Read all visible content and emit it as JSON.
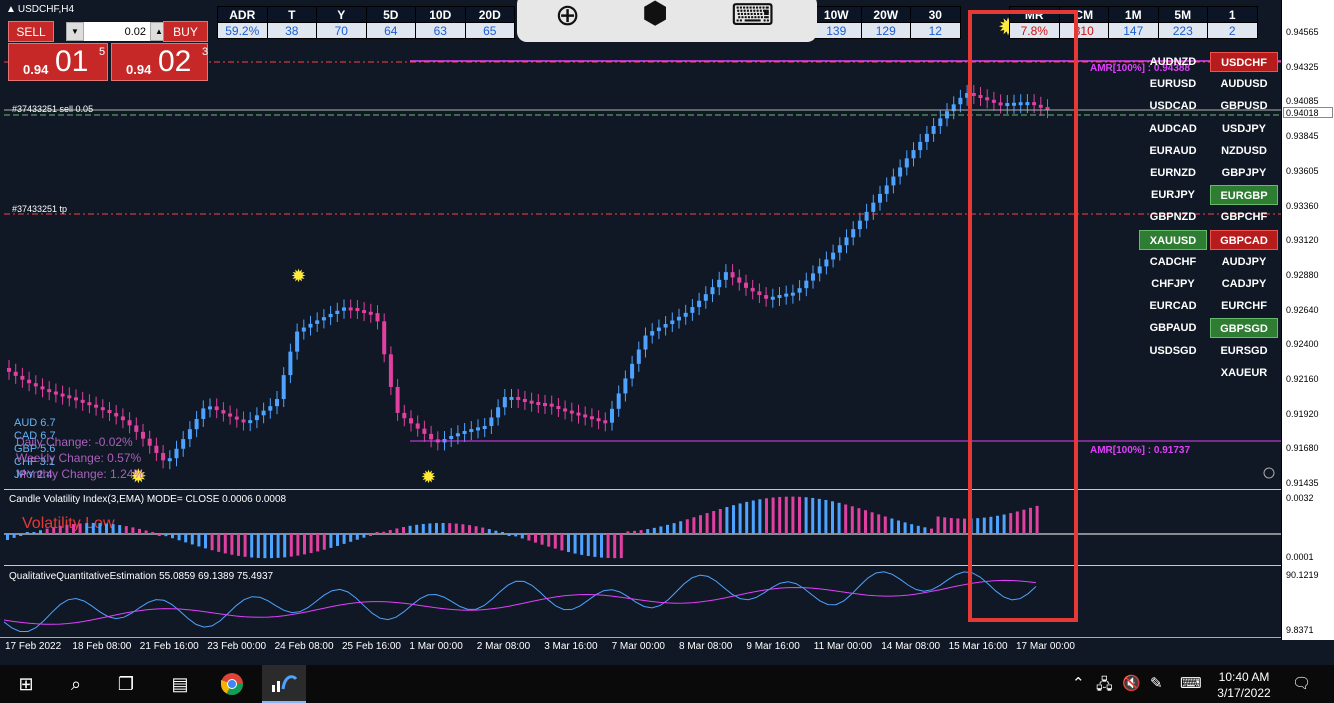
{
  "window": {
    "symbol": "USDCHF,H4"
  },
  "trade": {
    "sell_label": "SELL",
    "buy_label": "BUY",
    "lot": "0.02",
    "sell_small": "0.94",
    "sell_big": "01",
    "sell_sup": "5",
    "buy_small": "0.94",
    "buy_big": "02",
    "buy_sup": "3"
  },
  "stats": {
    "left": [
      {
        "h": "ADR",
        "v": "59.2%"
      },
      {
        "h": "T",
        "v": "38"
      },
      {
        "h": "Y",
        "v": "70"
      },
      {
        "h": "5D",
        "v": "64"
      },
      {
        "h": "10D",
        "v": "63"
      },
      {
        "h": "20D",
        "v": "65"
      }
    ],
    "right": [
      {
        "h": "10W",
        "v": "139"
      },
      {
        "h": "20W",
        "v": "129"
      },
      {
        "h": "30",
        "v": "12"
      }
    ],
    "right2": [
      {
        "h": "MR",
        "v": "7.8%",
        "red": true
      },
      {
        "h": "CM",
        "v": "310",
        "red": true
      },
      {
        "h": "1M",
        "v": "147"
      },
      {
        "h": "5M",
        "v": "223"
      },
      {
        "h": "1",
        "v": "2"
      }
    ],
    "frag": "3"
  },
  "price_axis": {
    "labels": [
      "0.94565",
      "0.94325",
      "0.94085",
      "0.93845",
      "0.93605",
      "0.93360",
      "0.93120",
      "0.92880",
      "0.92640",
      "0.92400",
      "0.92160",
      "0.91920",
      "0.91680",
      "0.91435"
    ],
    "current": "0.94018",
    "cvi_labels": [
      "0.0032",
      "0.0001"
    ],
    "qqe_labels": [
      "90.1219",
      "9.8371"
    ]
  },
  "orders": {
    "sell": "#37433251 sell 0.05",
    "tp": "#37433251 tp"
  },
  "amr": {
    "top": "AMR[100%] : 0.94388",
    "bottom": "AMR[100%] : 0.91737"
  },
  "pairs": [
    {
      "label": "AUDNZD",
      "style": ""
    },
    {
      "label": "USDCHF",
      "style": "red"
    },
    {
      "label": "EURUSD",
      "style": ""
    },
    {
      "label": "AUDUSD",
      "style": ""
    },
    {
      "label": "USDCAD",
      "style": ""
    },
    {
      "label": "GBPUSD",
      "style": ""
    },
    {
      "label": "AUDCAD",
      "style": ""
    },
    {
      "label": "USDJPY",
      "style": ""
    },
    {
      "label": "EURAUD",
      "style": ""
    },
    {
      "label": "NZDUSD",
      "style": ""
    },
    {
      "label": "EURNZD",
      "style": ""
    },
    {
      "label": "GBPJPY",
      "style": ""
    },
    {
      "label": "EURJPY",
      "style": ""
    },
    {
      "label": "EURGBP",
      "style": "green"
    },
    {
      "label": "GBPNZD",
      "style": ""
    },
    {
      "label": "GBPCHF",
      "style": ""
    },
    {
      "label": "XAUUSD",
      "style": "green"
    },
    {
      "label": "GBPCAD",
      "style": "red"
    },
    {
      "label": "CADCHF",
      "style": ""
    },
    {
      "label": "AUDJPY",
      "style": ""
    },
    {
      "label": "CHFJPY",
      "style": ""
    },
    {
      "label": "CADJPY",
      "style": ""
    },
    {
      "label": "EURCAD",
      "style": ""
    },
    {
      "label": "EURCHF",
      "style": ""
    },
    {
      "label": "GBPAUD",
      "style": ""
    },
    {
      "label": "GBPSGD",
      "style": "green"
    },
    {
      "label": "USDSGD",
      "style": ""
    },
    {
      "label": "EURSGD",
      "style": ""
    },
    {
      "label": "",
      "style": ""
    },
    {
      "label": "XAUEUR",
      "style": ""
    }
  ],
  "strength": [
    "AUD  6.7",
    "CAD  6.7",
    "GBP  5.6",
    "CHF  3.1",
    "JPY  2.4"
  ],
  "changes": [
    "Daily Change: -0.02%",
    "Weekly Change: 0.57%",
    "Monthly Change: 1.24%"
  ],
  "cvi": {
    "title": "Candle Volatility Index(3,EMA) MODE= CLOSE 0.0006 0.0008",
    "status": "Volatility Low"
  },
  "qqe": {
    "title": "QualitativeQuantitativeEstimation 55.0859 69.1389 75.4937"
  },
  "time_axis": [
    "17 Feb 2022",
    "18 Feb 08:00",
    "21 Feb 16:00",
    "23 Feb 00:00",
    "24 Feb 08:00",
    "25 Feb 16:00",
    "1 Mar 00:00",
    "2 Mar 08:00",
    "3 Mar 16:00",
    "7 Mar 00:00",
    "8 Mar 08:00",
    "9 Mar 16:00",
    "11 Mar 00:00",
    "14 Mar 08:00",
    "15 Mar 16:00",
    "17 Mar 00:00"
  ],
  "taskbar": {
    "time": "10:40 AM",
    "date": "3/17/2022"
  },
  "colors": {
    "bull": "#4da3ff",
    "bear": "#e040a0",
    "background": "#101826",
    "highlight": "#e53935"
  }
}
